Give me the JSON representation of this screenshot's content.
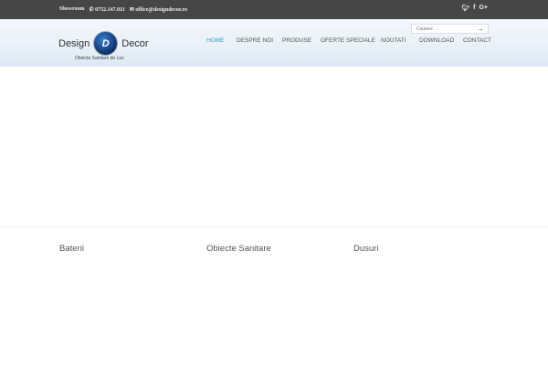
{
  "topbar": {
    "showroom_label": "Showroom",
    "phone": "0752.147.011",
    "email": "office@designdecor.ro",
    "social": [
      "twitter-icon",
      "facebook-icon",
      "google-plus-icon"
    ]
  },
  "header": {
    "logo_left": "Design",
    "logo_mark": "D",
    "logo_right": "Decor",
    "tagline": "Obiecte Sanitare de Lux",
    "search_placeholder": "Cautare ..."
  },
  "nav": {
    "items": [
      "HOME",
      "DESPRE NOI",
      "PRODUSE",
      "OFERTE SPECIALE",
      "NOUTATI",
      "DOWNLOAD",
      "CONTACT"
    ],
    "active": "HOME",
    "active_color": "#2aa4c8"
  },
  "categories": [
    "Baterii",
    "Obiecte Sanitare",
    "Dusuri"
  ]
}
